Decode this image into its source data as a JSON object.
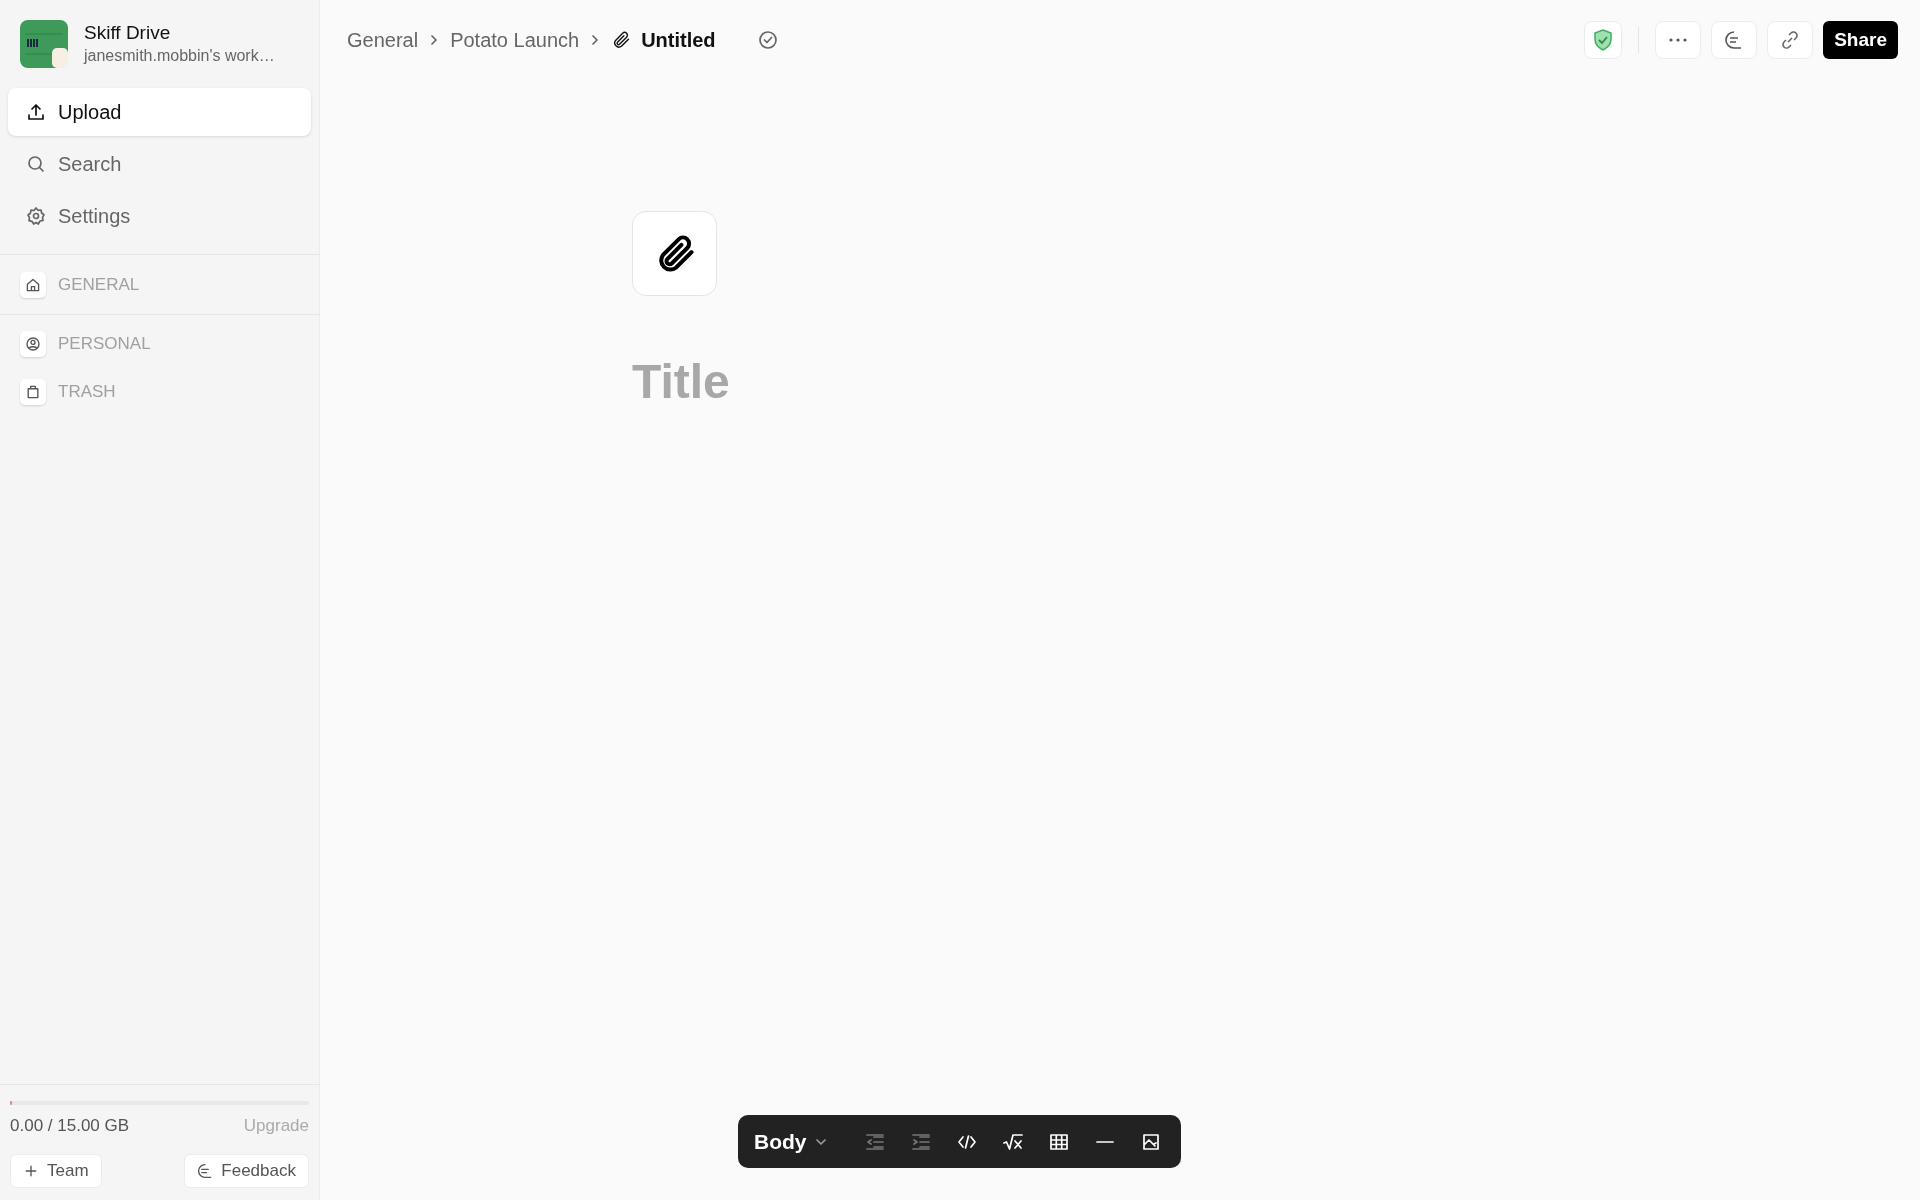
{
  "workspace": {
    "name": "Skiff Drive",
    "subtitle": "janesmith.mobbin's work…"
  },
  "nav": [
    {
      "kind": "upload",
      "label": "Upload",
      "selected": true
    },
    {
      "kind": "search",
      "label": "Search",
      "selected": false
    },
    {
      "kind": "settings",
      "label": "Settings",
      "selected": false
    }
  ],
  "sections": [
    {
      "kind": "home",
      "label": "GENERAL"
    },
    {
      "kind": "person",
      "label": "PERSONAL"
    },
    {
      "kind": "trash",
      "label": "TRASH"
    }
  ],
  "storage": {
    "usage": "0.00 / 15.00 GB",
    "level": 0.005,
    "upgrade": "Upgrade"
  },
  "footer_buttons": [
    {
      "kind": "team",
      "label": "Team"
    },
    {
      "kind": "feedback",
      "label": "Feedback"
    }
  ],
  "breadcrumbs": [
    "General",
    "Potato Launch",
    "Untitled"
  ],
  "share_button": "Share",
  "document": {
    "title_placeholder": "Title"
  },
  "toolbar": {
    "style": "Body",
    "tools": [
      {
        "kind": "outdent",
        "disabled": true
      },
      {
        "kind": "indent",
        "disabled": true
      },
      {
        "kind": "code",
        "disabled": false
      },
      {
        "kind": "math",
        "disabled": false
      },
      {
        "kind": "table",
        "disabled": false
      },
      {
        "kind": "rule",
        "disabled": false
      },
      {
        "kind": "image",
        "disabled": false
      }
    ]
  }
}
